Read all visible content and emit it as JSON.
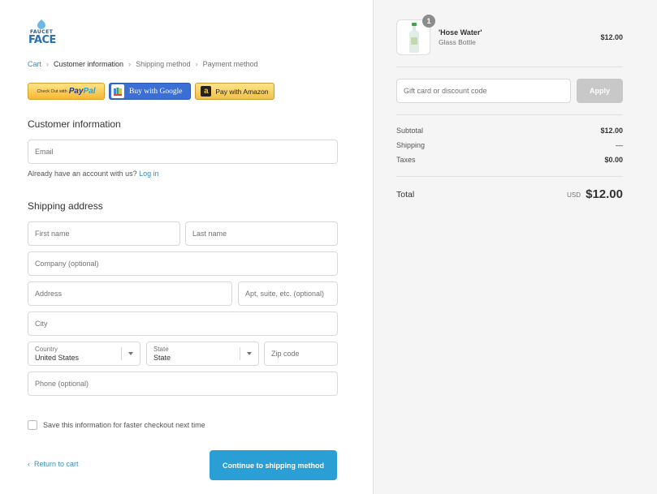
{
  "brand": {
    "logo_top": "FAUCET",
    "logo_bottom": "FACE"
  },
  "breadcrumb": {
    "items": [
      "Cart",
      "Customer information",
      "Shipping method",
      "Payment method"
    ],
    "separator": "›"
  },
  "express": {
    "paypal_small": "Check Out with",
    "paypal_pay": "Pay",
    "paypal_pal": "Pal",
    "google": "Buy with Google",
    "amazon_icon": "a",
    "amazon": "Pay with Amazon"
  },
  "customer": {
    "heading": "Customer information",
    "email_placeholder": "Email",
    "account_prompt": "Already have an account with us?",
    "login_link": "Log in"
  },
  "shipping": {
    "heading": "Shipping address",
    "first_name": "First name",
    "last_name": "Last name",
    "company": "Company (optional)",
    "address": "Address",
    "apt": "Apt, suite, etc. (optional)",
    "city": "City",
    "country_label": "Country",
    "country_value": "United States",
    "state_label": "State",
    "state_value": "State",
    "zip": "Zip code",
    "phone": "Phone (optional)"
  },
  "save_info": "Save this information for faster checkout next time",
  "footer": {
    "return_chevron": "‹",
    "return_label": "Return to cart",
    "continue_label": "Continue to shipping method"
  },
  "order": {
    "quantity": "1",
    "product_name": "'Hose Water'",
    "product_variant": "Glass Bottle",
    "product_price": "$12.00",
    "discount_placeholder": "Gift card or discount code",
    "apply_label": "Apply",
    "subtotal_label": "Subtotal",
    "subtotal_value": "$12.00",
    "shipping_label": "Shipping",
    "shipping_value": "—",
    "taxes_label": "Taxes",
    "taxes_value": "$0.00",
    "total_label": "Total",
    "total_currency": "USD",
    "total_value": "$12.00"
  },
  "colors": {
    "accent": "#2a9fd6",
    "link": "#338dbc",
    "sidebar_bg": "#f5f5f5",
    "apply_disabled": "#c8c8c8"
  },
  "icons": {
    "breadcrumb_separator": "chevron-right-icon",
    "return": "chevron-left-icon",
    "google_wallet": "google-wallet-icon",
    "amazon": "amazon-icon",
    "select_arrow": "chevron-down-icon"
  }
}
